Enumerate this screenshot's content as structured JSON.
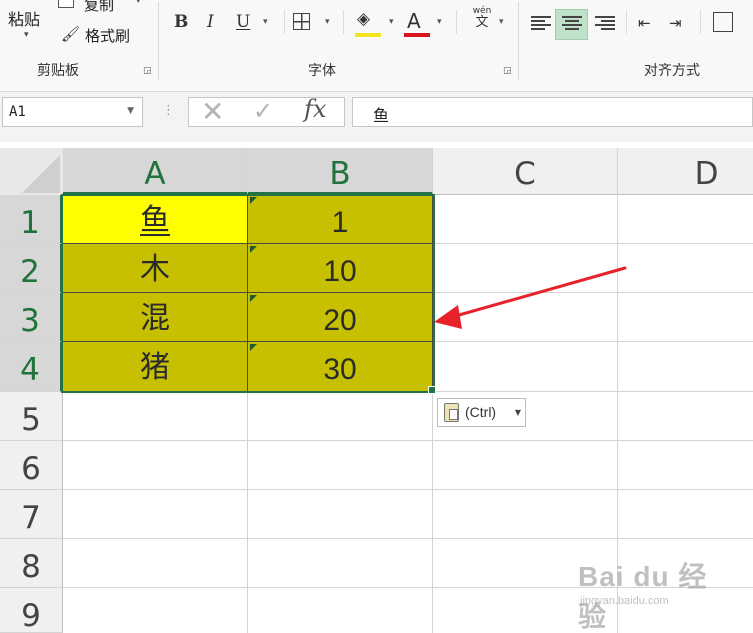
{
  "ribbon": {
    "clipboard": {
      "paste_label": "粘贴",
      "copy_label": "复制",
      "format_painter_label": "格式刷",
      "group_label": "剪贴板"
    },
    "font": {
      "bold": "B",
      "italic": "I",
      "underline": "U",
      "font_color_glyph": "A",
      "phonetic_pinyin": "wén",
      "phonetic_char": "文",
      "fill_color": "#f3e51c",
      "font_color": "#d9141b",
      "group_label": "字体"
    },
    "alignment": {
      "group_label": "对齐方式",
      "active": "center"
    }
  },
  "formula_bar": {
    "name_box": "A1",
    "cancel_glyph": "✕",
    "enter_glyph": "✓",
    "fx_label": "fx",
    "content": "鱼"
  },
  "sheet": {
    "columns": [
      "A",
      "B",
      "C",
      "D"
    ],
    "rows": [
      "1",
      "2",
      "3",
      "4",
      "5",
      "6",
      "7",
      "8",
      "9"
    ],
    "data": [
      [
        "鱼",
        "1"
      ],
      [
        "木",
        "10"
      ],
      [
        "混",
        "20"
      ],
      [
        "猪",
        "30"
      ]
    ],
    "fill_color": "#c6c000",
    "active_cell_color": "#ffff00",
    "selection_color": "#227447"
  },
  "paste_options": {
    "label": "(Ctrl)"
  },
  "watermark": {
    "text": "Bai du 经验",
    "sub": "jingyan.baidu.com"
  },
  "annotation": {
    "arrow_color": "#e8222a"
  }
}
